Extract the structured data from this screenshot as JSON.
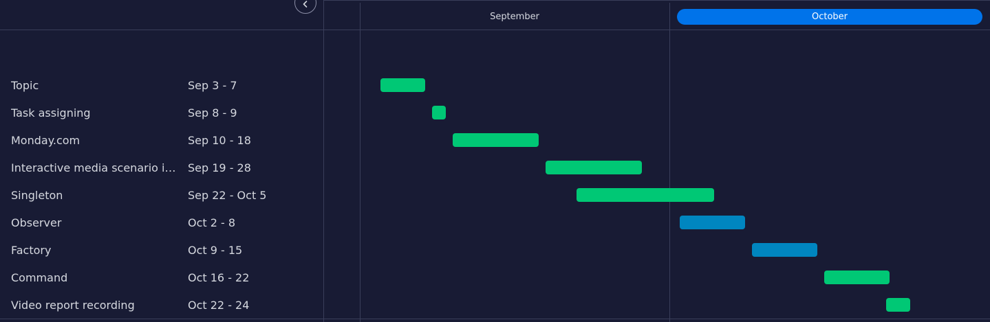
{
  "months": [
    {
      "label": "September",
      "active": false
    },
    {
      "label": "October",
      "active": true
    }
  ],
  "tasks": [
    {
      "name": "Topic",
      "dates": "Sep 3 - 7",
      "start": "Sep 3",
      "end": "Sep 7",
      "color": "#00c875"
    },
    {
      "name": "Task assigning",
      "dates": "Sep 8 - 9",
      "start": "Sep 8",
      "end": "Sep 9",
      "color": "#00c875"
    },
    {
      "name": "Monday.com",
      "dates": "Sep 10 - 18",
      "start": "Sep 10",
      "end": "Sep 18",
      "color": "#00c875"
    },
    {
      "name": "Interactive media scenario inf...",
      "dates": "Sep 19 - 28",
      "start": "Sep 19",
      "end": "Sep 28",
      "color": "#00c875"
    },
    {
      "name": "Singleton",
      "dates": "Sep 22 - Oct 5",
      "start": "Sep 22",
      "end": "Oct 5",
      "color": "#00c875"
    },
    {
      "name": "Observer",
      "dates": "Oct 2 - 8",
      "start": "Oct 2",
      "end": "Oct 8",
      "color": "#0086c0"
    },
    {
      "name": "Factory",
      "dates": "Oct 9 - 15",
      "start": "Oct 9",
      "end": "Oct 15",
      "color": "#0086c0"
    },
    {
      "name": "Command",
      "dates": "Oct 16 - 22",
      "start": "Oct 16",
      "end": "Oct 22",
      "color": "#00c875"
    },
    {
      "name": "Video report recording",
      "dates": "Oct 22 - 24",
      "start": "Oct 22",
      "end": "Oct 24",
      "color": "#00c875"
    }
  ],
  "icons": {
    "collapse": "chevron-left-icon"
  },
  "colors": {
    "background": "#181b34",
    "accent": "#0073ea",
    "done": "#00c875",
    "working": "#0086c0"
  }
}
